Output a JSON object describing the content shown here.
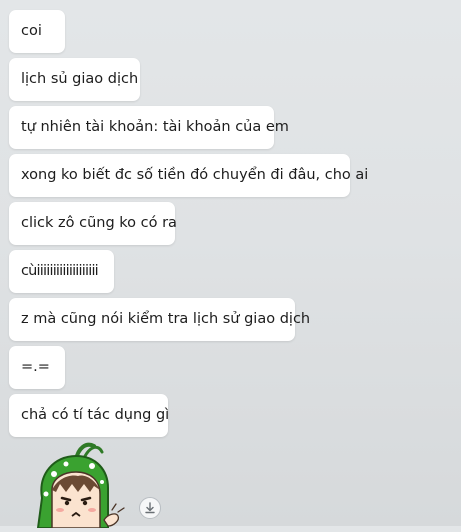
{
  "chat": {
    "messages": [
      {
        "text": "coi"
      },
      {
        "text": "lịch sủ giao dịch"
      },
      {
        "text": "tự nhiên tài khoản: tài khoản của em"
      },
      {
        "text": "xong ko biết đc số tiền đó chuyển đi đâu, cho ai"
      },
      {
        "text": "click zô cũng ko có ra"
      },
      {
        "text": "cùiiiiiiiiiiiiiiiiiii"
      },
      {
        "text": "z mà cũng nói kiểm tra lịch sử giao dịch"
      },
      {
        "text": "=.="
      },
      {
        "text": "chả có tí tác dụng gì"
      }
    ]
  },
  "sticker": {
    "icon": "cartoon-sticker-icon"
  },
  "download": {
    "icon": "download-icon"
  },
  "colors": {
    "bubble": "#ffffff",
    "background": "#e0e3e5",
    "text": "#1d1d1d"
  }
}
